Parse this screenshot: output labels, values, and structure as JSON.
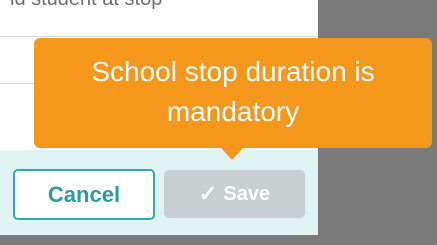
{
  "field": {
    "label": "ld student at stop"
  },
  "tooltip": {
    "message": "School stop duration is mandatory"
  },
  "footer": {
    "cancel_label": "Cancel",
    "save_label": "Save",
    "save_icon": "check-icon"
  },
  "colors": {
    "accent": "#2fa9b1",
    "tooltip_bg": "#f4971a",
    "footer_bg": "#dff3f2",
    "save_disabled_bg": "#c8cfd0",
    "overlay": "#7a7a7a"
  }
}
